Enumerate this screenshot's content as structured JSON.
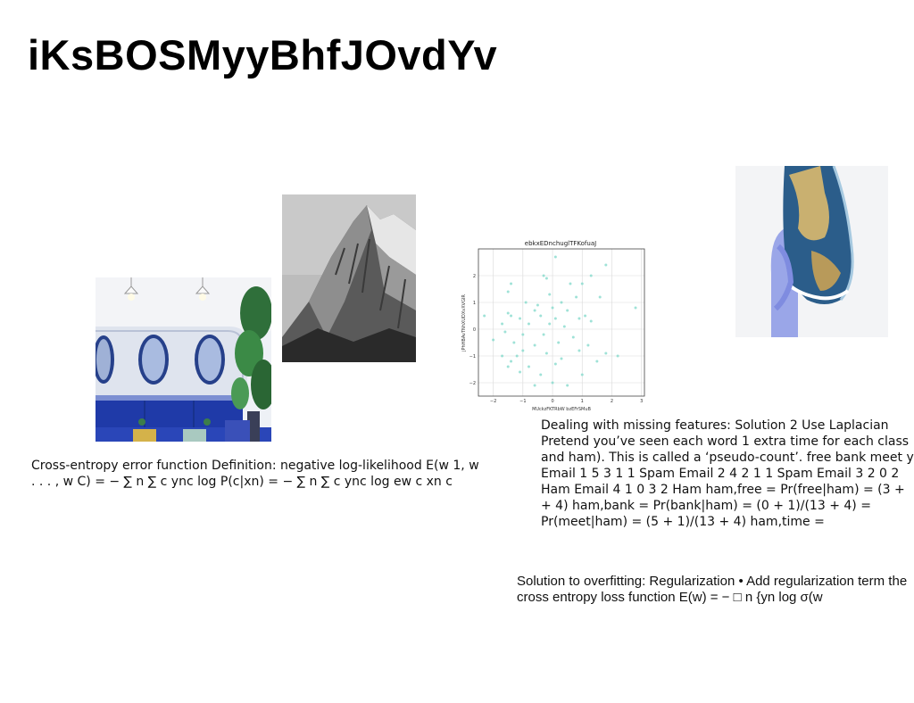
{
  "slide": {
    "title": "iKsBOSMyyBhfJOvdYv",
    "text_blocks": [
      "Cross-entropy error function Definition: negative log-likelihood E(w 1, w . . . , w C) = − ∑ n ∑ c ync log P(c|xn) = − ∑ n ∑ c ync log  ew  c xn  c",
      "Dealing with missing features: Solution 2 Use Laplacian Pretend you’ve seen each word 1 extra time for each class and ham). This is called a ‘pseudo-count’. free bank meet y Email 1 5 3 1 1 Spam Email 2 4 2 1 1 Spam Email 3 2 0 2 Ham Email 4 1 0 3 2 Ham ham,free = Pr(free|ham) = (3 + + 4) ham,bank = Pr(bank|ham) = (0 + 1)/(13 + 4) = Pr(meet|ham) = (5 + 1)/(13 + 4) ham,time =",
      "Solution to overfitting: Regularization • Add regularization term the cross entropy loss function E(w) = − □ n {yn log σ(w"
    ]
  },
  "images": {
    "cafe": "cafe-interior-photo",
    "mountain": "mountain-peak-photo",
    "globe": "hand-holding-globe-photo"
  },
  "chart_data": {
    "type": "scatter",
    "title": "ebkxEDnchuglTFKofuaJ",
    "xlabel": "MUckzFKTRbW bzEFrSMuB",
    "ylabel": "jPhHBAvTNhXUDXvXVGIR",
    "xlim": [
      -2.5,
      3.1
    ],
    "ylim": [
      -2.5,
      3.0
    ],
    "xticks": [
      -2,
      -1,
      0,
      1,
      2,
      3
    ],
    "yticks": [
      -2,
      -1,
      0,
      1,
      2
    ],
    "grid": true,
    "color": "#7fd8c9",
    "points": [
      [
        0.1,
        2.7
      ],
      [
        1.8,
        2.4
      ],
      [
        -0.3,
        2.0
      ],
      [
        0.6,
        1.7
      ],
      [
        1.0,
        1.7
      ],
      [
        -1.4,
        1.7
      ],
      [
        -1.5,
        1.4
      ],
      [
        -0.1,
        1.3
      ],
      [
        0.8,
        1.2
      ],
      [
        1.6,
        1.2
      ],
      [
        -0.9,
        1.0
      ],
      [
        0.3,
        1.0
      ],
      [
        -0.5,
        0.9
      ],
      [
        -2.3,
        0.5
      ],
      [
        -1.5,
        0.6
      ],
      [
        -1.4,
        0.5
      ],
      [
        -0.6,
        0.7
      ],
      [
        0.0,
        0.8
      ],
      [
        0.5,
        0.7
      ],
      [
        -0.4,
        0.5
      ],
      [
        1.1,
        0.5
      ],
      [
        2.8,
        0.8
      ],
      [
        -1.1,
        0.4
      ],
      [
        0.1,
        0.4
      ],
      [
        0.9,
        0.4
      ],
      [
        -1.7,
        0.2
      ],
      [
        -0.8,
        0.2
      ],
      [
        -0.1,
        0.2
      ],
      [
        0.4,
        0.1
      ],
      [
        1.3,
        0.3
      ],
      [
        -1.6,
        -0.1
      ],
      [
        -1.0,
        -0.2
      ],
      [
        -0.3,
        -0.2
      ],
      [
        0.7,
        -0.3
      ],
      [
        -2.0,
        -0.4
      ],
      [
        -1.3,
        -0.5
      ],
      [
        0.2,
        -0.5
      ],
      [
        -0.6,
        -0.6
      ],
      [
        1.2,
        -0.6
      ],
      [
        -1.0,
        -0.8
      ],
      [
        0.9,
        -0.8
      ],
      [
        -0.2,
        -0.9
      ],
      [
        -1.7,
        -1.0
      ],
      [
        -1.2,
        -1.0
      ],
      [
        1.8,
        -0.9
      ],
      [
        2.2,
        -1.0
      ],
      [
        1.5,
        -1.2
      ],
      [
        -1.5,
        -1.4
      ],
      [
        -0.8,
        -1.4
      ],
      [
        0.1,
        -1.3
      ],
      [
        -1.1,
        -1.6
      ],
      [
        -0.4,
        -1.7
      ],
      [
        1.0,
        -1.7
      ],
      [
        0.0,
        -2.0
      ],
      [
        0.5,
        -2.1
      ],
      [
        -0.6,
        -2.1
      ],
      [
        -1.4,
        -1.2
      ],
      [
        0.3,
        -1.1
      ],
      [
        -0.2,
        1.9
      ],
      [
        1.3,
        2.0
      ]
    ]
  }
}
